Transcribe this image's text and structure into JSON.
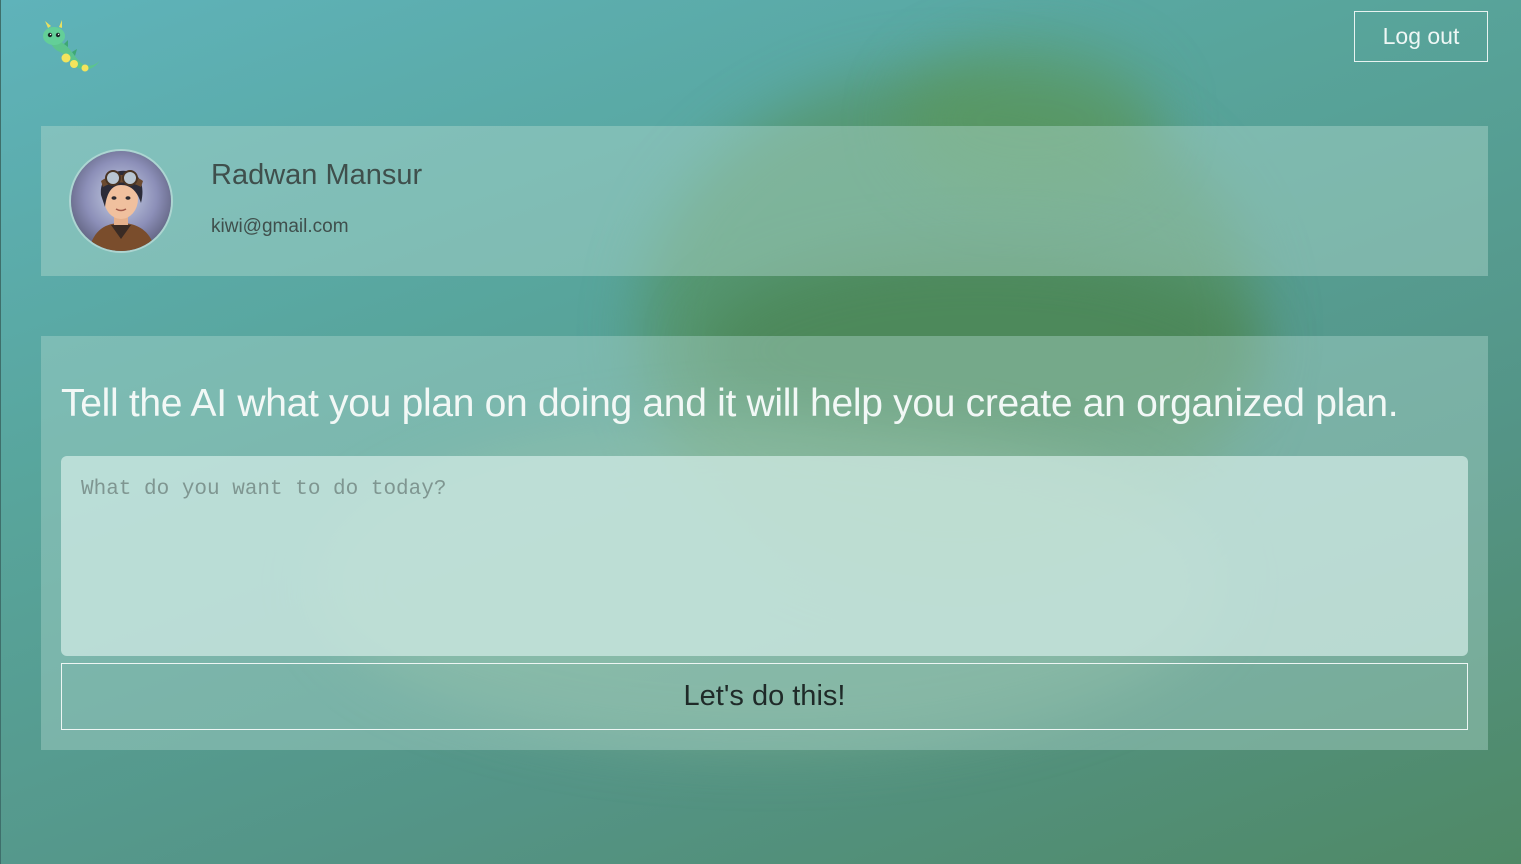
{
  "header": {
    "logo_name": "dragon-mascot-logo",
    "logout_label": "Log out"
  },
  "profile": {
    "name": "Radwan Mansur",
    "email": "kiwi@gmail.com"
  },
  "planner": {
    "headline": "Tell the AI what you plan on doing and it will help you create an organized plan.",
    "input_value": "",
    "input_placeholder": "What do you want to do today?",
    "submit_label": "Let's do this!"
  },
  "colors": {
    "background_top": "#5fb3ba",
    "background_bottom": "#4f8966",
    "card_overlay": "#afd7cd",
    "input_fill": "#d2ebe6",
    "text_dark": "#3f4f4c",
    "text_light": "#f2f8f6"
  }
}
